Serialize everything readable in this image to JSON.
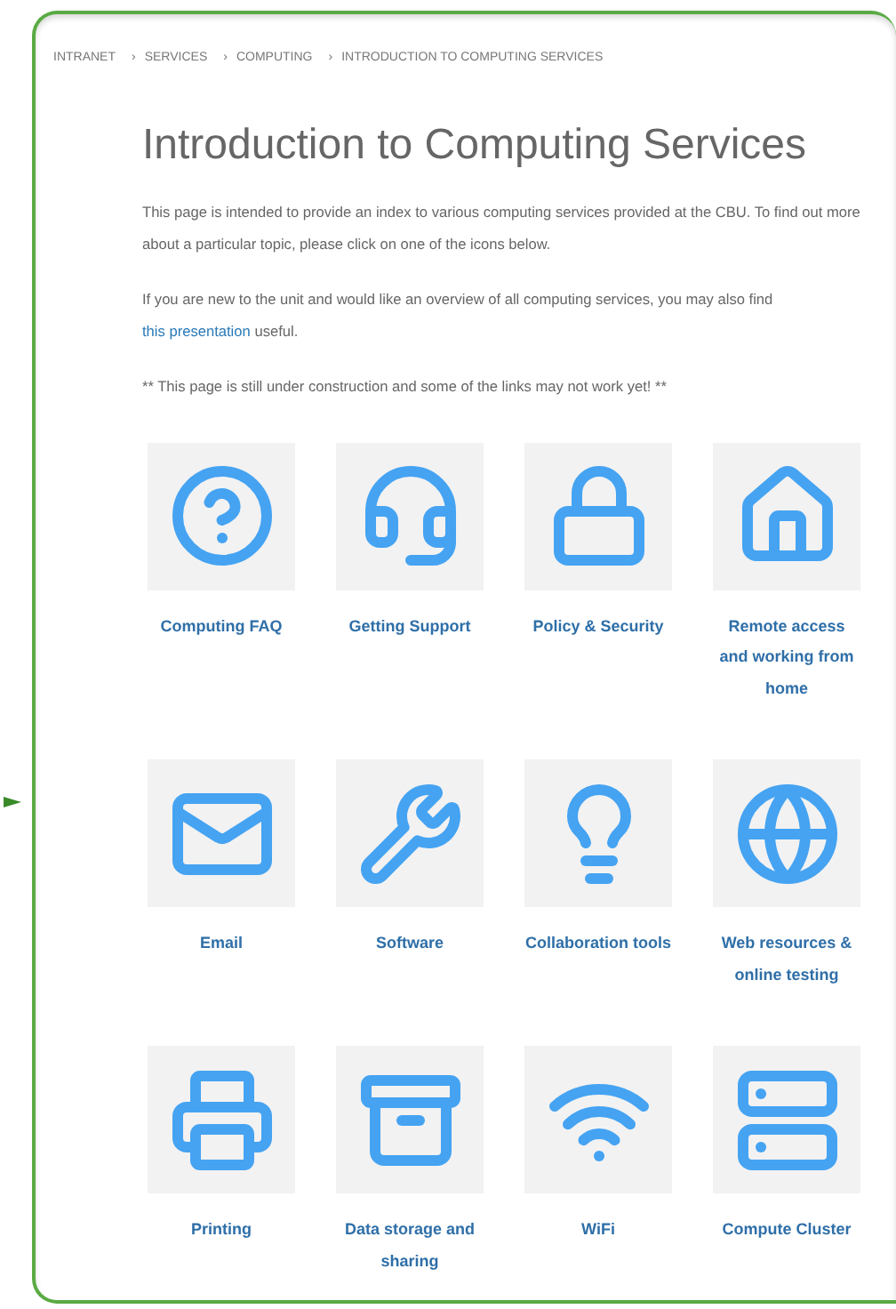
{
  "breadcrumb": {
    "separator": "›",
    "items": [
      "INTRANET",
      "SERVICES",
      "COMPUTING",
      "INTRODUCTION TO COMPUTING SERVICES"
    ]
  },
  "title": "Introduction to Computing Services",
  "intro": "This page is intended to provide an index to various computing services provided at the CBU. To find out more about a particular topic, please click on one of the icons below.",
  "overview": {
    "before": "If you are new to the unit and would like an overview of all computing services, you may also find",
    "link": "this presentation",
    "after": "useful."
  },
  "notice": "** This page is still under construction and some of the links may not work yet! **",
  "tiles": [
    {
      "label": "Computing FAQ"
    },
    {
      "label": "Getting Support"
    },
    {
      "label": "Policy & Security"
    },
    {
      "label": "Remote access and working from home"
    },
    {
      "label": "Email"
    },
    {
      "label": "Software"
    },
    {
      "label": "Collaboration tools"
    },
    {
      "label": "Web resources & online testing"
    },
    {
      "label": "Printing"
    },
    {
      "label": "Data storage and sharing"
    },
    {
      "label": "WiFi"
    },
    {
      "label": "Compute Cluster"
    }
  ]
}
